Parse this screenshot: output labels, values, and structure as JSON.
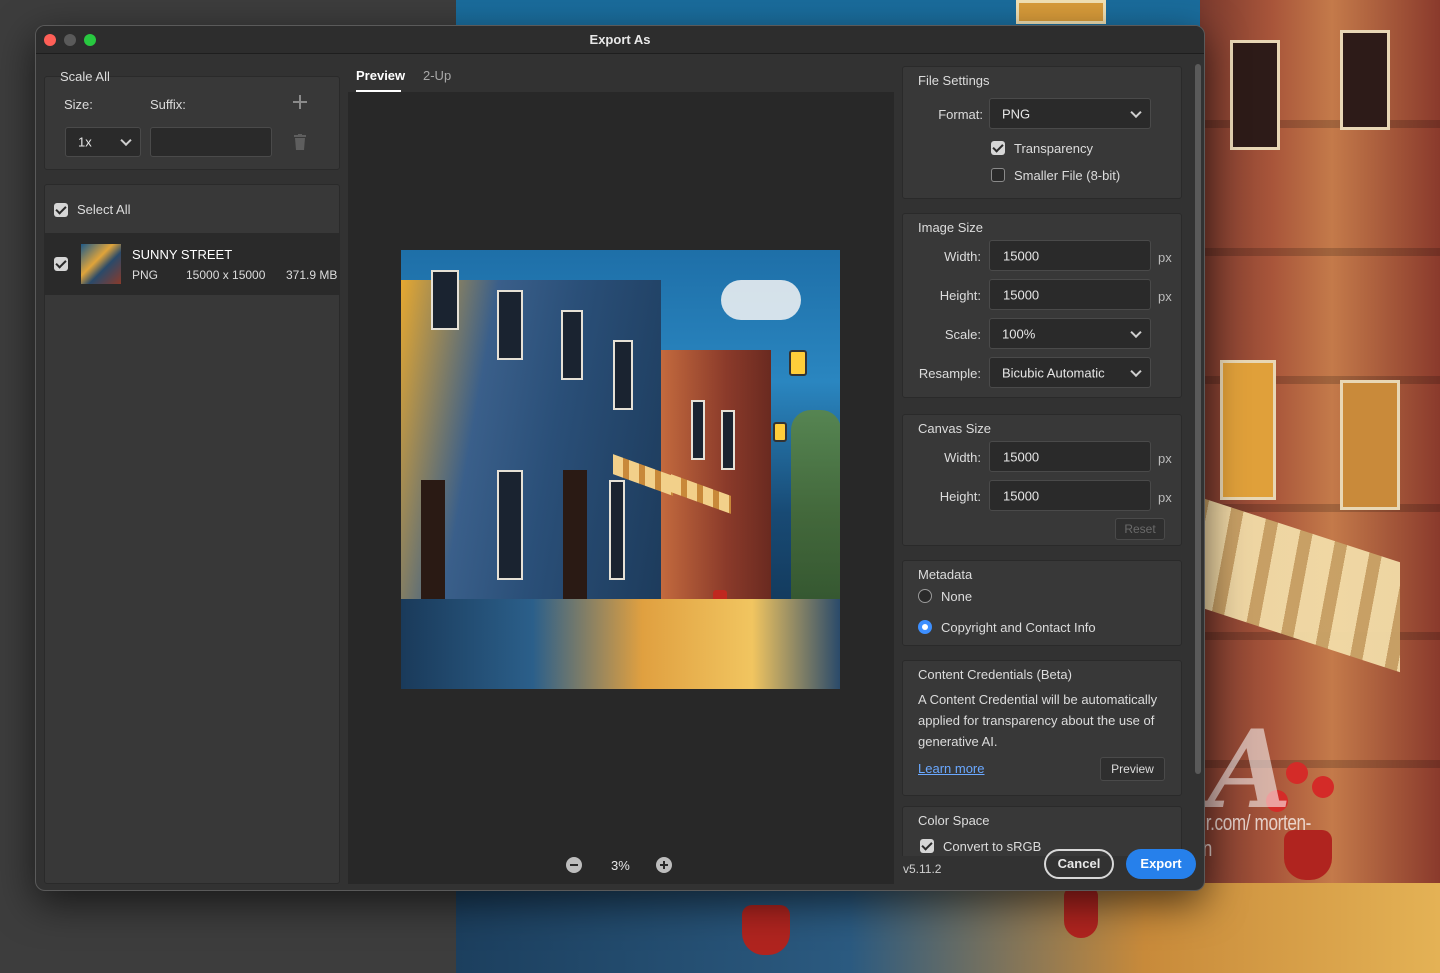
{
  "window": {
    "title": "Export As",
    "version": "v5.11.2"
  },
  "scale_all": {
    "title": "Scale All",
    "size_label": "Size:",
    "suffix_label": "Suffix:",
    "size_value": "1x",
    "suffix_value": ""
  },
  "files": {
    "select_all_label": "Select All",
    "select_all_checked": true,
    "items": [
      {
        "name": "SUNNY STREET",
        "format": "PNG",
        "dimensions": "15000 x 15000",
        "size": "371.9 MB",
        "checked": true
      }
    ]
  },
  "preview": {
    "tabs": [
      "Preview",
      "2-Up"
    ],
    "active_tab": "Preview",
    "zoom": "3%"
  },
  "file_settings": {
    "title": "File Settings",
    "format_label": "Format:",
    "format_value": "PNG",
    "transparency_label": "Transparency",
    "transparency_checked": true,
    "smaller_file_label": "Smaller File (8-bit)",
    "smaller_file_checked": false
  },
  "image_size": {
    "title": "Image Size",
    "width_label": "Width:",
    "width_value": "15000",
    "height_label": "Height:",
    "height_value": "15000",
    "unit": "px",
    "scale_label": "Scale:",
    "scale_value": "100%",
    "resample_label": "Resample:",
    "resample_value": "Bicubic Automatic"
  },
  "canvas_size": {
    "title": "Canvas Size",
    "width_label": "Width:",
    "width_value": "15000",
    "height_label": "Height:",
    "height_value": "15000",
    "unit": "px",
    "reset_label": "Reset"
  },
  "metadata": {
    "title": "Metadata",
    "options": [
      "None",
      "Copyright and Contact Info"
    ],
    "selected": "Copyright and Contact Info"
  },
  "content_credentials": {
    "title": "Content Credentials (Beta)",
    "line1": "A Content Credential will be automatically",
    "line2": "applied for transparency about the use of",
    "line3": "generative AI.",
    "learn_more": "Learn more",
    "preview_button": "Preview"
  },
  "color_space": {
    "title": "Color Space",
    "convert_label": "Convert to sRGB",
    "convert_checked": true
  },
  "actions": {
    "cancel": "Cancel",
    "export": "Export"
  },
  "background": {
    "watermark_letter": "A",
    "watermark_text": "©Artmajeur.com/ morten-klementsen"
  },
  "colors": {
    "accent": "#2680eb",
    "link": "#6aa8ff",
    "radio_selected": "#3d8fff",
    "dialog_bg": "#323232"
  }
}
